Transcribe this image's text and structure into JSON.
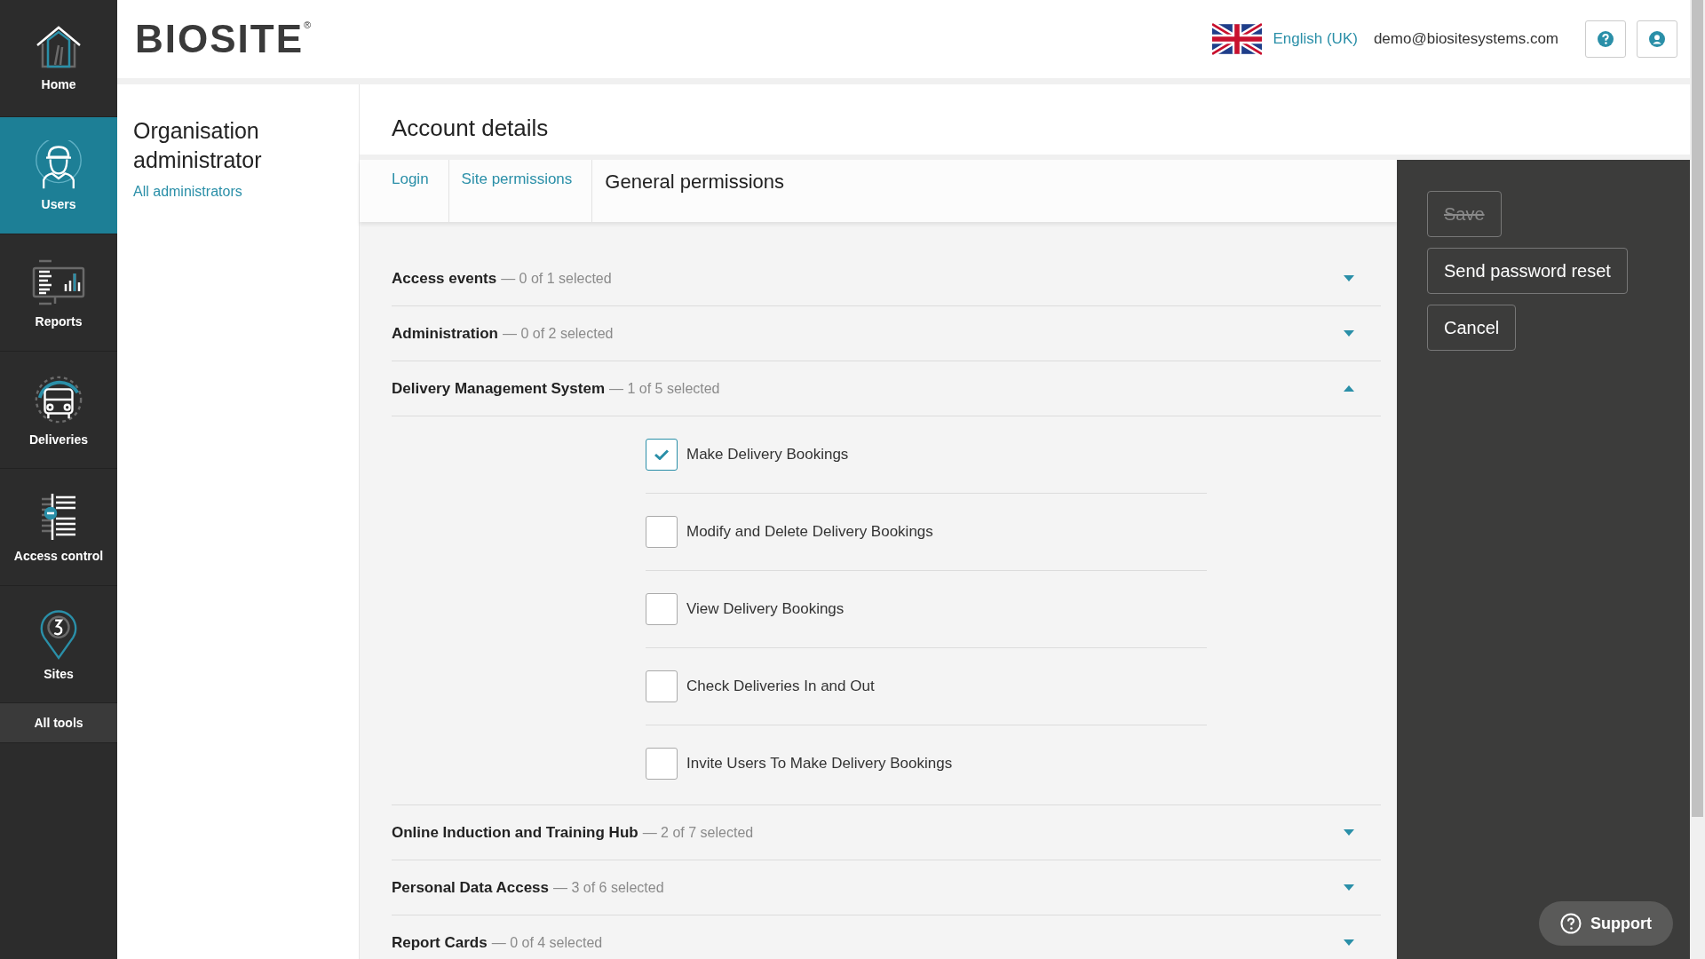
{
  "sidebar": {
    "items": [
      {
        "kind": "home",
        "label": "Home",
        "selected": false
      },
      {
        "kind": "users",
        "label": "Users",
        "selected": true
      },
      {
        "kind": "reports",
        "label": "Reports",
        "selected": false
      },
      {
        "kind": "deliveries",
        "label": "Deliveries",
        "selected": false
      },
      {
        "kind": "access",
        "label": "Access control",
        "selected": false
      },
      {
        "kind": "sites",
        "label": "Sites",
        "selected": false
      },
      {
        "kind": "text",
        "label": "All tools",
        "selected": false
      }
    ]
  },
  "header": {
    "logo": "BIOSITE",
    "logo_mark": "®",
    "language": "English (UK)",
    "email": "demo@biositesystems.com"
  },
  "user_panel": {
    "title": "Organisation administrator",
    "link": "All administrators"
  },
  "page": {
    "title": "Account details"
  },
  "tabs": [
    {
      "label": "Login",
      "selected": false
    },
    {
      "label": "Site permissions",
      "selected": false
    },
    {
      "label": "General permissions",
      "selected": true
    }
  ],
  "sections": [
    {
      "title": "Access events",
      "summary": "— 0 of 1 selected",
      "expanded": false
    },
    {
      "title": "Administration",
      "summary": "— 0 of 2 selected",
      "expanded": false
    },
    {
      "title": "Delivery Management System",
      "summary": "— 1 of 5 selected",
      "expanded": true,
      "options": [
        {
          "label": "Make Delivery Bookings",
          "checked": true
        },
        {
          "label": "Modify and Delete Delivery Bookings",
          "checked": false
        },
        {
          "label": "View Delivery Bookings",
          "checked": false
        },
        {
          "label": "Check Deliveries In and Out",
          "checked": false
        },
        {
          "label": "Invite Users To Make Delivery Bookings",
          "checked": false
        }
      ]
    },
    {
      "title": "Online Induction and Training Hub",
      "summary": "— 2 of 7 selected",
      "expanded": false
    },
    {
      "title": "Personal Data Access",
      "summary": "— 3 of 6 selected",
      "expanded": false
    },
    {
      "title": "Report Cards",
      "summary": "— 0 of 4 selected",
      "expanded": false
    }
  ],
  "actions": [
    {
      "label": "Save",
      "disabled": true
    },
    {
      "label": "Send password reset",
      "disabled": false
    },
    {
      "label": "Cancel",
      "disabled": false
    }
  ],
  "support": {
    "label": "Support"
  }
}
